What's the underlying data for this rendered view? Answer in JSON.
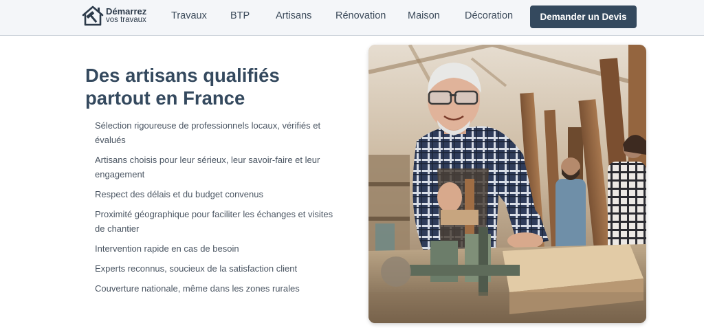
{
  "brand": {
    "line1": "Démarrez",
    "line2": "vos travaux",
    "icon": "house-hammer-icon"
  },
  "nav": {
    "items": [
      {
        "label": "Travaux"
      },
      {
        "label": "BTP"
      },
      {
        "label": "Artisans"
      },
      {
        "label": "Rénovation"
      },
      {
        "label": "Maison"
      },
      {
        "label": "Décoration"
      }
    ],
    "cta_label": "Demander un Devis"
  },
  "main": {
    "heading": "Des artisans qualifiés partout en France",
    "features": [
      "Sélection rigoureuse de professionnels locaux, vérifiés et évalués",
      "Artisans choisis pour leur sérieux, leur savoir-faire et leur engagement",
      "Respect des délais et du budget convenus",
      "Proximité géographique pour faciliter les échanges et visites de chantier",
      "Intervention rapide en cas de besoin",
      "Experts reconnus, soucieux de la satisfaction client",
      "Couverture nationale, même dans les zones rurales"
    ]
  },
  "colors": {
    "header_bg": "#f4f6f9",
    "accent": "#34495e",
    "heading": "#34495e",
    "text": "#4a5562"
  }
}
